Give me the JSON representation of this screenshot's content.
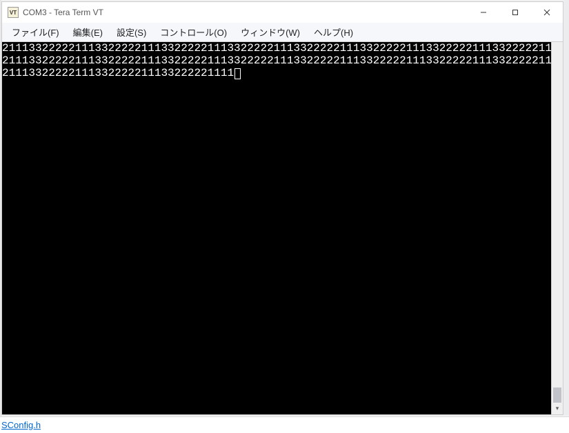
{
  "window": {
    "icon_label": "VT",
    "title": "COM3 - Tera Term VT"
  },
  "win_controls": {
    "minimize": "minimize",
    "maximize": "maximize",
    "close": "close"
  },
  "menu": {
    "file": "ファイル(F)",
    "edit": "編集(E)",
    "setting": "設定(S)",
    "control": "コントロール(O)",
    "window": "ウィンドウ(W)",
    "help": "ヘルプ(H)"
  },
  "terminal": {
    "lines": [
      "2111332222211133222221113322222111332222211133222221113322222111332222211133222221113322222",
      "2111332222211133222221113322222111332222211133222221113322222111332222211133222221113322222",
      "21113322222111332222211133222221111"
    ]
  },
  "bottom": {
    "link_text": "SConfig.h"
  }
}
